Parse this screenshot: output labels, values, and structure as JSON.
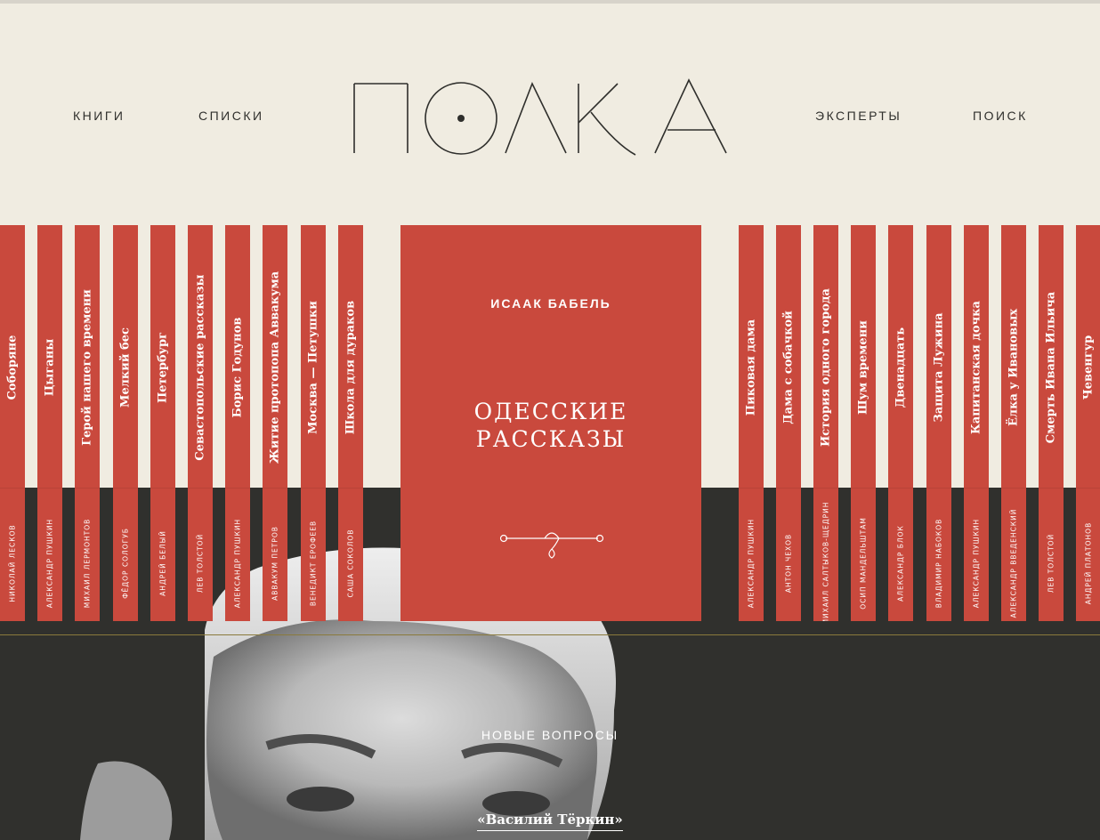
{
  "header": {
    "logo_text": "ПОЛКА",
    "nav_left": [
      "КНИГИ",
      "СПИСКИ"
    ],
    "nav_right": [
      "ЭКСПЕРТЫ",
      "ПОИСК"
    ]
  },
  "shelf_left": [
    {
      "title": "Соборяне",
      "author": "НИКОЛАЙ ЛЕСКОВ"
    },
    {
      "title": "Цыганы",
      "author": "АЛЕКСАНДР ПУШКИН"
    },
    {
      "title": "Герой нашего времени",
      "author": "МИХАИЛ ЛЕРМОНТОВ"
    },
    {
      "title": "Мелкий бес",
      "author": "ФЁДОР СОЛОГУБ"
    },
    {
      "title": "Петербург",
      "author": "АНДРЕЙ БЕЛЫЙ"
    },
    {
      "title": "Севастопольские рассказы",
      "author": "ЛЕВ ТОЛСТОЙ"
    },
    {
      "title": "Борис Годунов",
      "author": "АЛЕКСАНДР ПУШКИН"
    },
    {
      "title": "Житие протопопа Аввакума",
      "author": "АВВАКУМ ПЕТРОВ"
    },
    {
      "title": "Москва — Петушки",
      "author": "ВЕНЕДИКТ ЕРОФЕЕВ"
    },
    {
      "title": "Школа для дураков",
      "author": "САША СОКОЛОВ"
    }
  ],
  "featured": {
    "author": "ИСААК БАБЕЛЬ",
    "title_line1": "ОДЕССКИЕ",
    "title_line2": "РАССКАЗЫ"
  },
  "shelf_right": [
    {
      "title": "Пиковая дама",
      "author": "АЛЕКСАНДР ПУШКИН"
    },
    {
      "title": "Дама с собачкой",
      "author": "АНТОН ЧЕХОВ"
    },
    {
      "title": "История одного города",
      "author": "МИХАИЛ САЛТЫКОВ-ЩЕДРИН"
    },
    {
      "title": "Шум времени",
      "author": "ОСИП МАНДЕЛЬШТАМ"
    },
    {
      "title": "Двенадцать",
      "author": "АЛЕКСАНДР БЛОК"
    },
    {
      "title": "Защита Лужина",
      "author": "ВЛАДИМИР НАБОКОВ"
    },
    {
      "title": "Капитанская дочка",
      "author": "АЛЕКСАНДР ПУШКИН"
    },
    {
      "title": "Ёлка у Ивановых",
      "author": "АЛЕКСАНДР ВВЕДЕНСКИЙ"
    },
    {
      "title": "Смерть Ивана Ильича",
      "author": "ЛЕВ ТОЛСТОЙ"
    },
    {
      "title": "Чевенгур",
      "author": "АНДРЕЙ ПЛАТОНОВ"
    }
  ],
  "new_questions": {
    "label": "НОВЫЕ ВОПРОСЫ",
    "link": "«Василий Тёркин»"
  },
  "colors": {
    "background": "#f0ece1",
    "spine": "#c9493d",
    "dark": "#30302d",
    "text_dark": "#2f2f2c"
  }
}
